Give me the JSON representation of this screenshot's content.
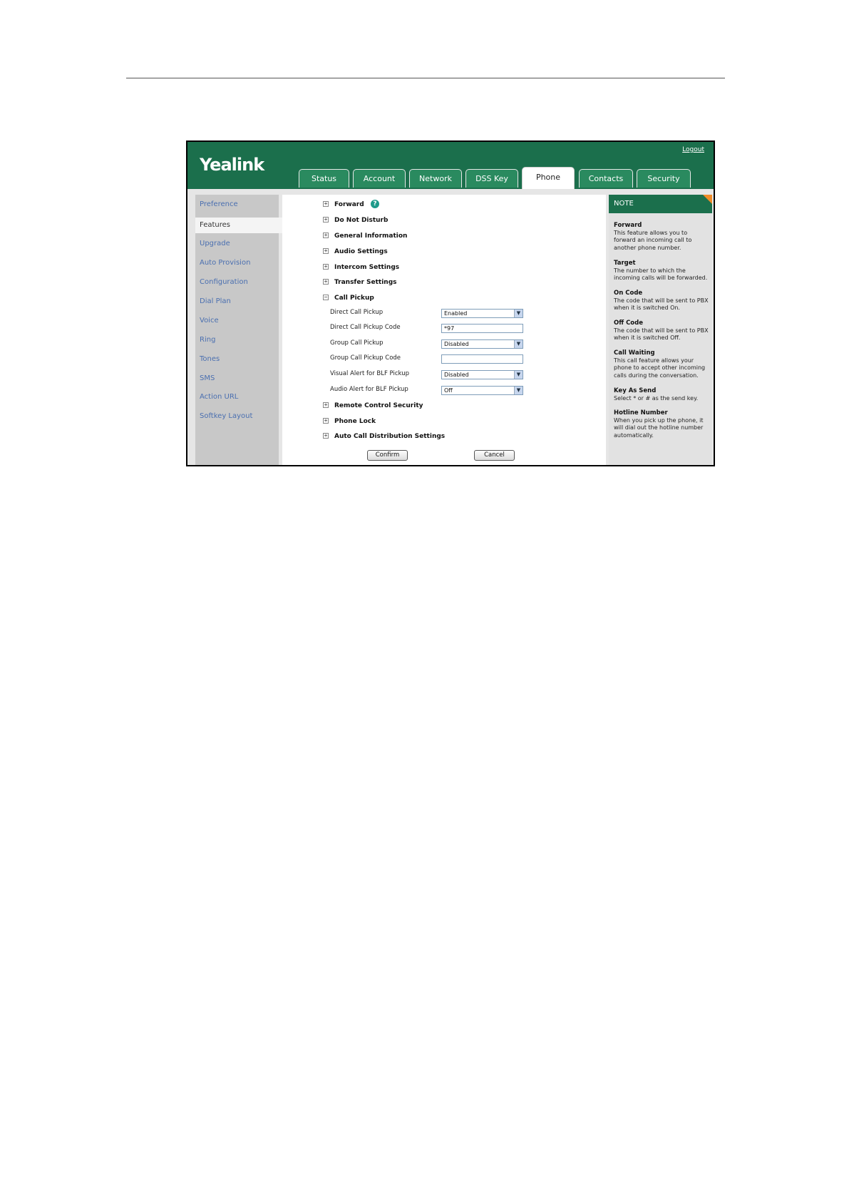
{
  "header": {
    "logo": "Yealink",
    "logout": "Logout"
  },
  "tabs": [
    {
      "label": "Status"
    },
    {
      "label": "Account"
    },
    {
      "label": "Network"
    },
    {
      "label": "DSS Key"
    },
    {
      "label": "Phone",
      "active": true
    },
    {
      "label": "Contacts"
    },
    {
      "label": "Security"
    }
  ],
  "sidebar": {
    "items": [
      {
        "label": "Preference"
      },
      {
        "label": "Features",
        "active": true
      },
      {
        "label": "Upgrade"
      },
      {
        "label": "Auto Provision"
      },
      {
        "label": "Configuration"
      },
      {
        "label": "Dial Plan"
      },
      {
        "label": "Voice"
      },
      {
        "label": "Ring"
      },
      {
        "label": "Tones"
      },
      {
        "label": "SMS"
      },
      {
        "label": "Action URL"
      },
      {
        "label": "Softkey Layout"
      }
    ]
  },
  "sections": [
    {
      "label": "Forward",
      "expanded": false,
      "help": "?"
    },
    {
      "label": "Do Not Disturb",
      "expanded": false
    },
    {
      "label": "General Information",
      "expanded": false
    },
    {
      "label": "Audio Settings",
      "expanded": false
    },
    {
      "label": "Intercom Settings",
      "expanded": false
    },
    {
      "label": "Transfer Settings",
      "expanded": false
    },
    {
      "label": "Call Pickup",
      "expanded": true
    },
    {
      "label": "Remote Control Security",
      "expanded": false
    },
    {
      "label": "Phone Lock",
      "expanded": false
    },
    {
      "label": "Auto Call Distribution Settings",
      "expanded": false
    }
  ],
  "section_symbols": {
    "collapsed": "+",
    "expanded": "−"
  },
  "call_pickup_fields": [
    {
      "label": "Direct Call Pickup",
      "type": "select",
      "value": "Enabled"
    },
    {
      "label": "Direct Call Pickup Code",
      "type": "text",
      "value": "*97"
    },
    {
      "label": "Group Call Pickup",
      "type": "select",
      "value": "Disabled"
    },
    {
      "label": "Group Call Pickup Code",
      "type": "text",
      "value": ""
    },
    {
      "label": "Visual Alert for BLF Pickup",
      "type": "select",
      "value": "Disabled"
    },
    {
      "label": "Audio Alert for BLF Pickup",
      "type": "select",
      "value": "Off"
    }
  ],
  "buttons": {
    "confirm": "Confirm",
    "cancel": "Cancel"
  },
  "note": {
    "title": "NOTE",
    "items": [
      {
        "title": "Forward",
        "text": "This feature allows you to forward an incoming call to another phone number."
      },
      {
        "title": "Target",
        "text": "The number to which the incoming calls will be forwarded."
      },
      {
        "title": "On Code",
        "text": "The code that will be sent to PBX when it is switched On."
      },
      {
        "title": "Off Code",
        "text": "The code that will be sent to PBX when it is switched Off."
      },
      {
        "title": "Call Waiting",
        "text": "This call feature allows your phone to accept other incoming calls during the conversation."
      },
      {
        "title": "Key As Send",
        "text": "Select * or # as the send key."
      },
      {
        "title": "Hotline Number",
        "text": "When you pick up the phone, it will dial out the hotline number automatically."
      }
    ]
  },
  "colors": {
    "brand": "#1b6f4c",
    "tab": "#2a8a5f",
    "sidebar_link": "#4a6fb0",
    "note_corner": "#f08c28"
  }
}
